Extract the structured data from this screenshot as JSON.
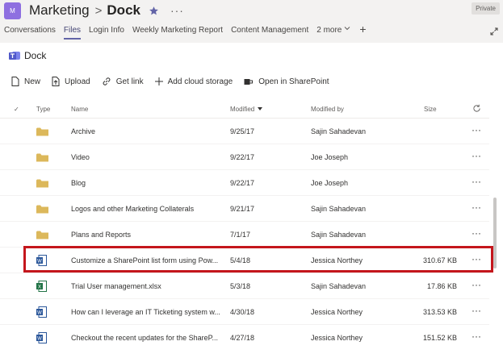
{
  "header": {
    "avatar_initial": "M",
    "team": "Marketing",
    "separator": ">",
    "channel": "Dock",
    "more": "···",
    "privacy_badge": "Private"
  },
  "tabs": [
    {
      "label": "Conversations",
      "active": false
    },
    {
      "label": "Files",
      "active": true
    },
    {
      "label": "Login Info",
      "active": false
    },
    {
      "label": "Weekly Marketing Report",
      "active": false
    },
    {
      "label": "Content Management",
      "active": false
    },
    {
      "label": "2 more",
      "active": false
    }
  ],
  "add_tab": "+",
  "library": {
    "title": "Dock"
  },
  "commands": {
    "new": "New",
    "upload": "Upload",
    "get_link": "Get link",
    "add_cloud": "Add cloud storage",
    "open_sharepoint": "Open in SharePoint"
  },
  "columns": {
    "check": "✓",
    "type": "Type",
    "name": "Name",
    "modified": "Modified",
    "modified_by": "Modified by",
    "size": "Size"
  },
  "files": [
    {
      "type": "folder",
      "name": "Archive",
      "modified": "9/25/17",
      "modified_by": "Sajin Sahadevan",
      "size": ""
    },
    {
      "type": "folder",
      "name": "Video",
      "modified": "9/22/17",
      "modified_by": "Joe Joseph",
      "size": ""
    },
    {
      "type": "folder",
      "name": "Blog",
      "modified": "9/22/17",
      "modified_by": "Joe Joseph",
      "size": ""
    },
    {
      "type": "folder",
      "name": "Logos and other Marketing Collaterals",
      "modified": "9/21/17",
      "modified_by": "Sajin Sahadevan",
      "size": ""
    },
    {
      "type": "folder",
      "name": "Plans and Reports",
      "modified": "7/1/17",
      "modified_by": "Sajin Sahadevan",
      "size": ""
    },
    {
      "type": "word",
      "name": "Customize a SharePoint list form using Pow...",
      "modified": "5/4/18",
      "modified_by": "Jessica Northey",
      "size": "310.67 KB"
    },
    {
      "type": "excel",
      "name": "Trial User management.xlsx",
      "modified": "5/3/18",
      "modified_by": "Sajin Sahadevan",
      "size": "17.86 KB"
    },
    {
      "type": "word",
      "name": "How can I leverage an IT Ticketing system w...",
      "modified": "4/30/18",
      "modified_by": "Jessica Northey",
      "size": "313.53 KB"
    },
    {
      "type": "word",
      "name": "Checkout the recent updates for the ShareP...",
      "modified": "4/27/18",
      "modified_by": "Jessica Northey",
      "size": "151.52 KB"
    }
  ],
  "row_more": "···",
  "colors": {
    "accent": "#6264a7",
    "folder": "#dcb85b",
    "word": "#2b579a",
    "excel": "#217346",
    "highlight": "#c4161c"
  }
}
